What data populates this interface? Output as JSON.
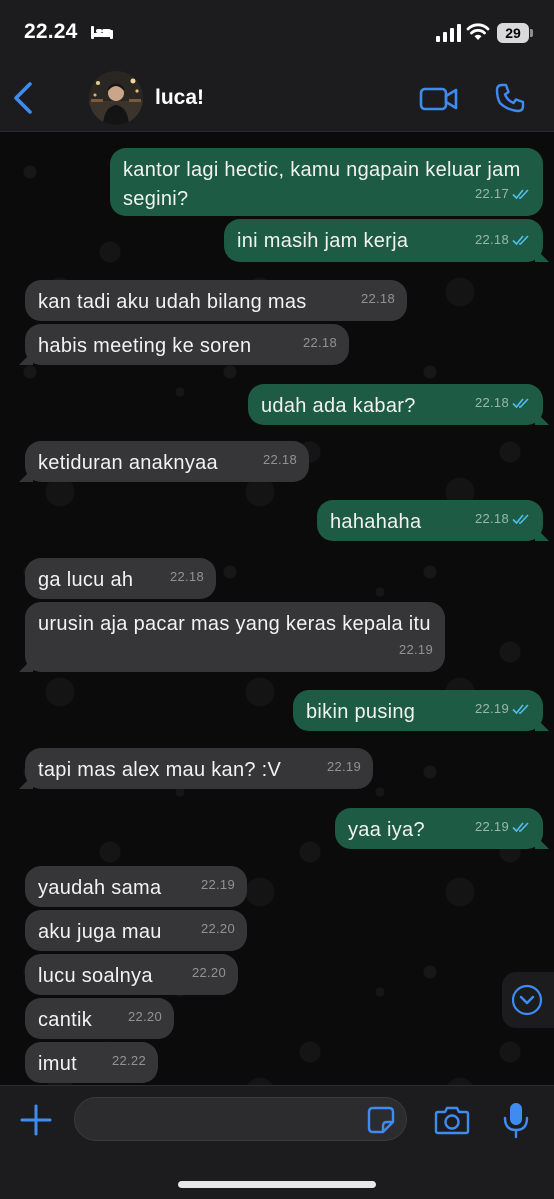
{
  "status_bar": {
    "time": "22.24",
    "battery": "29"
  },
  "header": {
    "contact_name": "luca!"
  },
  "messages": [
    {
      "dir": "out",
      "text": "kantor lagi hectic, kamu ngapain keluar jam segini?",
      "time": "22.17"
    },
    {
      "dir": "out",
      "text": "ini masih jam kerja",
      "time": "22.18"
    },
    {
      "dir": "in",
      "text": "kan tadi aku udah bilang mas",
      "time": "22.18"
    },
    {
      "dir": "in",
      "text": "habis meeting ke soren",
      "time": "22.18"
    },
    {
      "dir": "out",
      "text": "udah ada kabar?",
      "time": "22.18"
    },
    {
      "dir": "in",
      "text": "ketiduran anaknyaa",
      "time": "22.18"
    },
    {
      "dir": "out",
      "text": "hahahaha",
      "time": "22.18"
    },
    {
      "dir": "in",
      "text": "ga lucu ah",
      "time": "22.18"
    },
    {
      "dir": "in",
      "text": "urusin aja pacar mas yang keras kepala itu",
      "time": "22.19"
    },
    {
      "dir": "out",
      "text": "bikin pusing",
      "time": "22.19"
    },
    {
      "dir": "in",
      "text": "tapi mas alex mau kan? :V",
      "time": "22.19"
    },
    {
      "dir": "out",
      "text": "yaa iya?",
      "time": "22.19"
    },
    {
      "dir": "in",
      "text": "yaudah sama",
      "time": "22.19"
    },
    {
      "dir": "in",
      "text": "aku juga mau",
      "time": "22.20"
    },
    {
      "dir": "in",
      "text": "lucu soalnya",
      "time": "22.20"
    },
    {
      "dir": "in",
      "text": "cantik",
      "time": "22.20"
    },
    {
      "dir": "in",
      "text": "imut",
      "time": "22.22"
    }
  ],
  "composer": {
    "value": "",
    "placeholder": ""
  },
  "colors": {
    "accent": "#3e8cf0",
    "bubble_out": "#1d5b45",
    "bubble_in": "#363638",
    "read_ticks": "#53bdeb"
  },
  "icons": [
    "sleep-icon",
    "signal-icon",
    "wifi-icon",
    "back-icon",
    "video-call-icon",
    "phone-call-icon",
    "chevron-down-icon",
    "plus-icon",
    "sticker-icon",
    "camera-icon",
    "microphone-icon",
    "double-check-icon"
  ]
}
